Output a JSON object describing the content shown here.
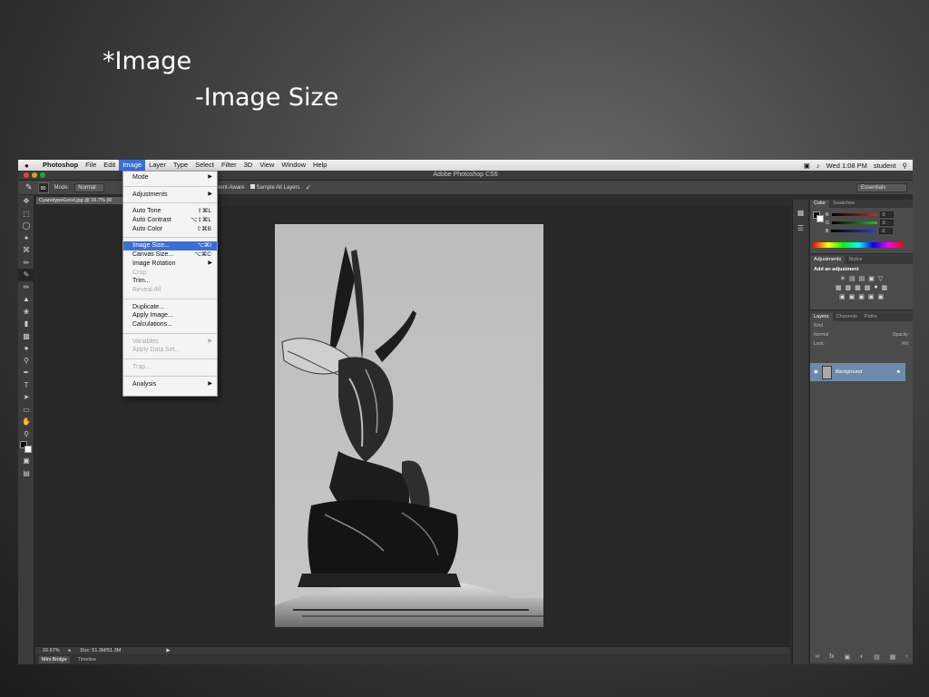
{
  "slide": {
    "heading": "*Image",
    "subheading": "-Image Size"
  },
  "menubar": {
    "apple": "",
    "items": [
      "Photoshop",
      "File",
      "Edit",
      "Image",
      "Layer",
      "Type",
      "Select",
      "Filter",
      "3D",
      "View",
      "Window",
      "Help"
    ],
    "active": "Image",
    "clock": "Wed 1:08 PM",
    "user": "student",
    "search_icon": "magnifier"
  },
  "window": {
    "title": "Adobe Photoshop CS6",
    "document_tab": "CyanotypeGood.jpg @ 16.7% (R"
  },
  "options_bar": {
    "brush_size": "90",
    "mode_label": "Mode:",
    "mode_value": "Normal",
    "type_option": "Content-Aware",
    "sample_all_layers": "Sample All Layers",
    "workspace": "Essentials"
  },
  "image_menu": {
    "items": [
      {
        "label": "Mode",
        "shortcut": "",
        "submenu": true,
        "disabled": false
      },
      {
        "sep": true
      },
      {
        "label": "Adjustments",
        "shortcut": "",
        "submenu": true,
        "disabled": false
      },
      {
        "sep": true
      },
      {
        "label": "Auto Tone",
        "shortcut": "⇧⌘L",
        "submenu": false,
        "disabled": false
      },
      {
        "label": "Auto Contrast",
        "shortcut": "⌥⇧⌘L",
        "submenu": false,
        "disabled": false
      },
      {
        "label": "Auto Color",
        "shortcut": "⇧⌘B",
        "submenu": false,
        "disabled": false
      },
      {
        "sep": true
      },
      {
        "label": "Image Size...",
        "shortcut": "⌥⌘I",
        "submenu": false,
        "disabled": false,
        "highlighted": true
      },
      {
        "label": "Canvas Size...",
        "shortcut": "⌥⌘C",
        "submenu": false,
        "disabled": false
      },
      {
        "label": "Image Rotation",
        "shortcut": "",
        "submenu": true,
        "disabled": false
      },
      {
        "label": "Crop",
        "shortcut": "",
        "submenu": false,
        "disabled": true
      },
      {
        "label": "Trim...",
        "shortcut": "",
        "submenu": false,
        "disabled": false
      },
      {
        "label": "Reveal All",
        "shortcut": "",
        "submenu": false,
        "disabled": true
      },
      {
        "sep": true
      },
      {
        "label": "Duplicate...",
        "shortcut": "",
        "submenu": false,
        "disabled": false
      },
      {
        "label": "Apply Image...",
        "shortcut": "",
        "submenu": false,
        "disabled": false
      },
      {
        "label": "Calculations...",
        "shortcut": "",
        "submenu": false,
        "disabled": false
      },
      {
        "sep": true
      },
      {
        "label": "Variables",
        "shortcut": "",
        "submenu": true,
        "disabled": true
      },
      {
        "label": "Apply Data Set...",
        "shortcut": "",
        "submenu": false,
        "disabled": true
      },
      {
        "sep": true
      },
      {
        "label": "Trap...",
        "shortcut": "",
        "submenu": false,
        "disabled": true
      },
      {
        "sep": true
      },
      {
        "label": "Analysis",
        "shortcut": "",
        "submenu": true,
        "disabled": false
      }
    ]
  },
  "status": {
    "zoom": "16.67%",
    "doc": "Doc: 51.3M/51.3M"
  },
  "bottom_tabs": [
    "Mini Bridge",
    "Timeline"
  ],
  "color_panel": {
    "tabs": [
      "Color",
      "Swatches"
    ],
    "channels": [
      {
        "label": "R",
        "value": "0",
        "color": "#e02020"
      },
      {
        "label": "G",
        "value": "0",
        "color": "#20c020"
      },
      {
        "label": "B",
        "value": "0",
        "color": "#2040e0"
      }
    ]
  },
  "adjustments_panel": {
    "tabs": [
      "Adjustments",
      "Styles"
    ],
    "title": "Add an adjustment"
  },
  "layers_panel": {
    "tabs": [
      "Layers",
      "Channels",
      "Paths"
    ],
    "kind": "Kind",
    "blend": "Normal",
    "opacity_label": "Opacity:",
    "lock_label": "Lock:",
    "fill_label": "Fill:",
    "layer_name": "Background"
  }
}
